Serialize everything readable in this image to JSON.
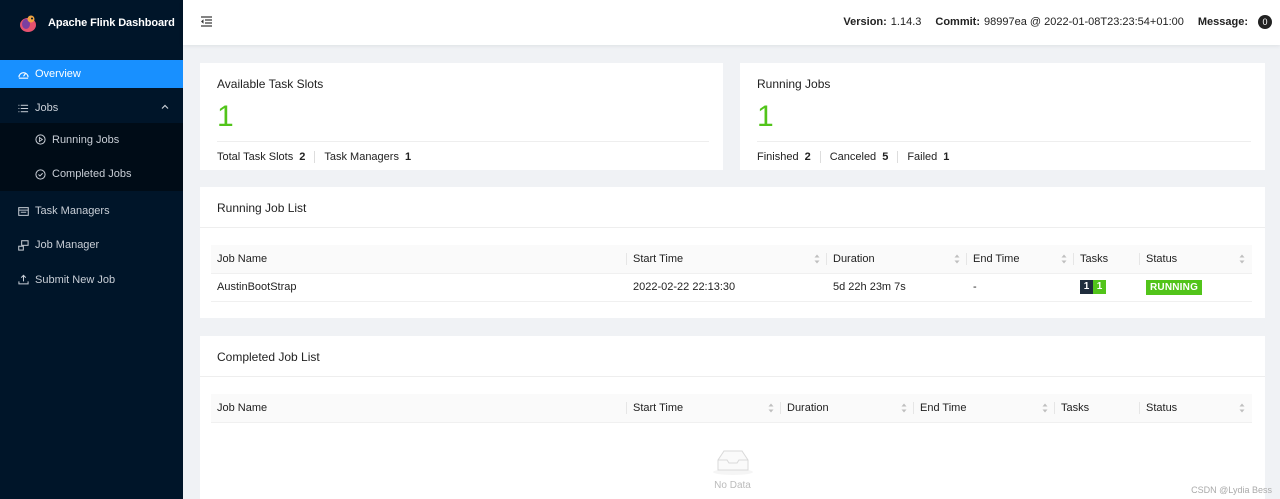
{
  "app": {
    "title": "Apache Flink Dashboard"
  },
  "sidebar": {
    "items": [
      {
        "label": "Overview"
      },
      {
        "label": "Jobs"
      },
      {
        "label": "Running Jobs"
      },
      {
        "label": "Completed Jobs"
      },
      {
        "label": "Task Managers"
      },
      {
        "label": "Job Manager"
      },
      {
        "label": "Submit New Job"
      }
    ]
  },
  "header": {
    "version_label": "Version:",
    "version_value": "1.14.3",
    "commit_label": "Commit:",
    "commit_value": "98997ea @ 2022-01-08T23:23:54+01:00",
    "message_label": "Message:",
    "message_count": "0"
  },
  "slots_card": {
    "title": "Available Task Slots",
    "value": "1",
    "stats": [
      {
        "label": "Total Task Slots",
        "value": "2"
      },
      {
        "label": "Task Managers",
        "value": "1"
      }
    ]
  },
  "jobs_card": {
    "title": "Running Jobs",
    "value": "1",
    "stats": [
      {
        "label": "Finished",
        "value": "2"
      },
      {
        "label": "Canceled",
        "value": "5"
      },
      {
        "label": "Failed",
        "value": "1"
      }
    ]
  },
  "running_list": {
    "title": "Running Job List",
    "columns": [
      "Job Name",
      "Start Time",
      "Duration",
      "End Time",
      "Tasks",
      "Status"
    ],
    "rows": [
      {
        "job_name": "AustinBootStrap",
        "start_time": "2022-02-22 22:13:30",
        "duration": "5d 22h 23m 7s",
        "end_time": "-",
        "tasks": [
          "1",
          "1"
        ],
        "status": "RUNNING"
      }
    ]
  },
  "completed_list": {
    "title": "Completed Job List",
    "columns": [
      "Job Name",
      "Start Time",
      "Duration",
      "End Time",
      "Tasks",
      "Status"
    ],
    "empty_text": "No Data"
  },
  "colors": {
    "sidebar_bg": "#001529",
    "accent": "#1890ff",
    "success": "#52c41a"
  },
  "watermark": "CSDN @Lydia Bess"
}
